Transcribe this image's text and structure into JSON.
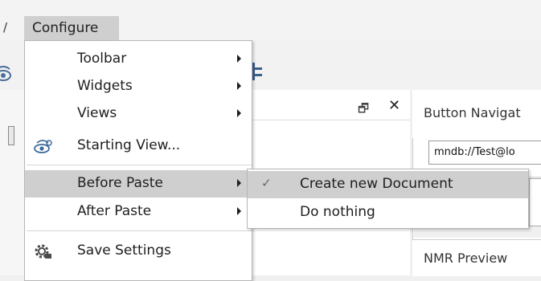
{
  "menubar": {
    "partial_label": "/",
    "configure_label": "Configure"
  },
  "configure_menu": {
    "items": [
      {
        "label": "Toolbar",
        "has_submenu": true
      },
      {
        "label": "Widgets",
        "has_submenu": true
      },
      {
        "label": "Views",
        "has_submenu": true
      },
      {
        "label": "Starting View...",
        "icon": "starting-view-icon"
      },
      {
        "label": "Before Paste",
        "has_submenu": true,
        "highlighted": true
      },
      {
        "label": "After Paste",
        "has_submenu": true
      },
      {
        "label": "Save Settings",
        "icon": "gear-icon"
      }
    ]
  },
  "before_paste_submenu": {
    "items": [
      {
        "label": "Create new Document",
        "checked": true,
        "check_glyph": "✓",
        "highlighted": true
      },
      {
        "label": "Do nothing",
        "checked": false
      }
    ]
  },
  "panels": {
    "center": {
      "float_icon": "🗗",
      "close_icon": "✕"
    },
    "right": {
      "title": "Button Navigat",
      "url_value": "mndb://Test@lo",
      "preview_title": "NMR Preview"
    }
  },
  "colors": {
    "highlight": "#cfcfcf",
    "menu_bg": "#ffffff",
    "app_bg": "#f0f0f0"
  }
}
